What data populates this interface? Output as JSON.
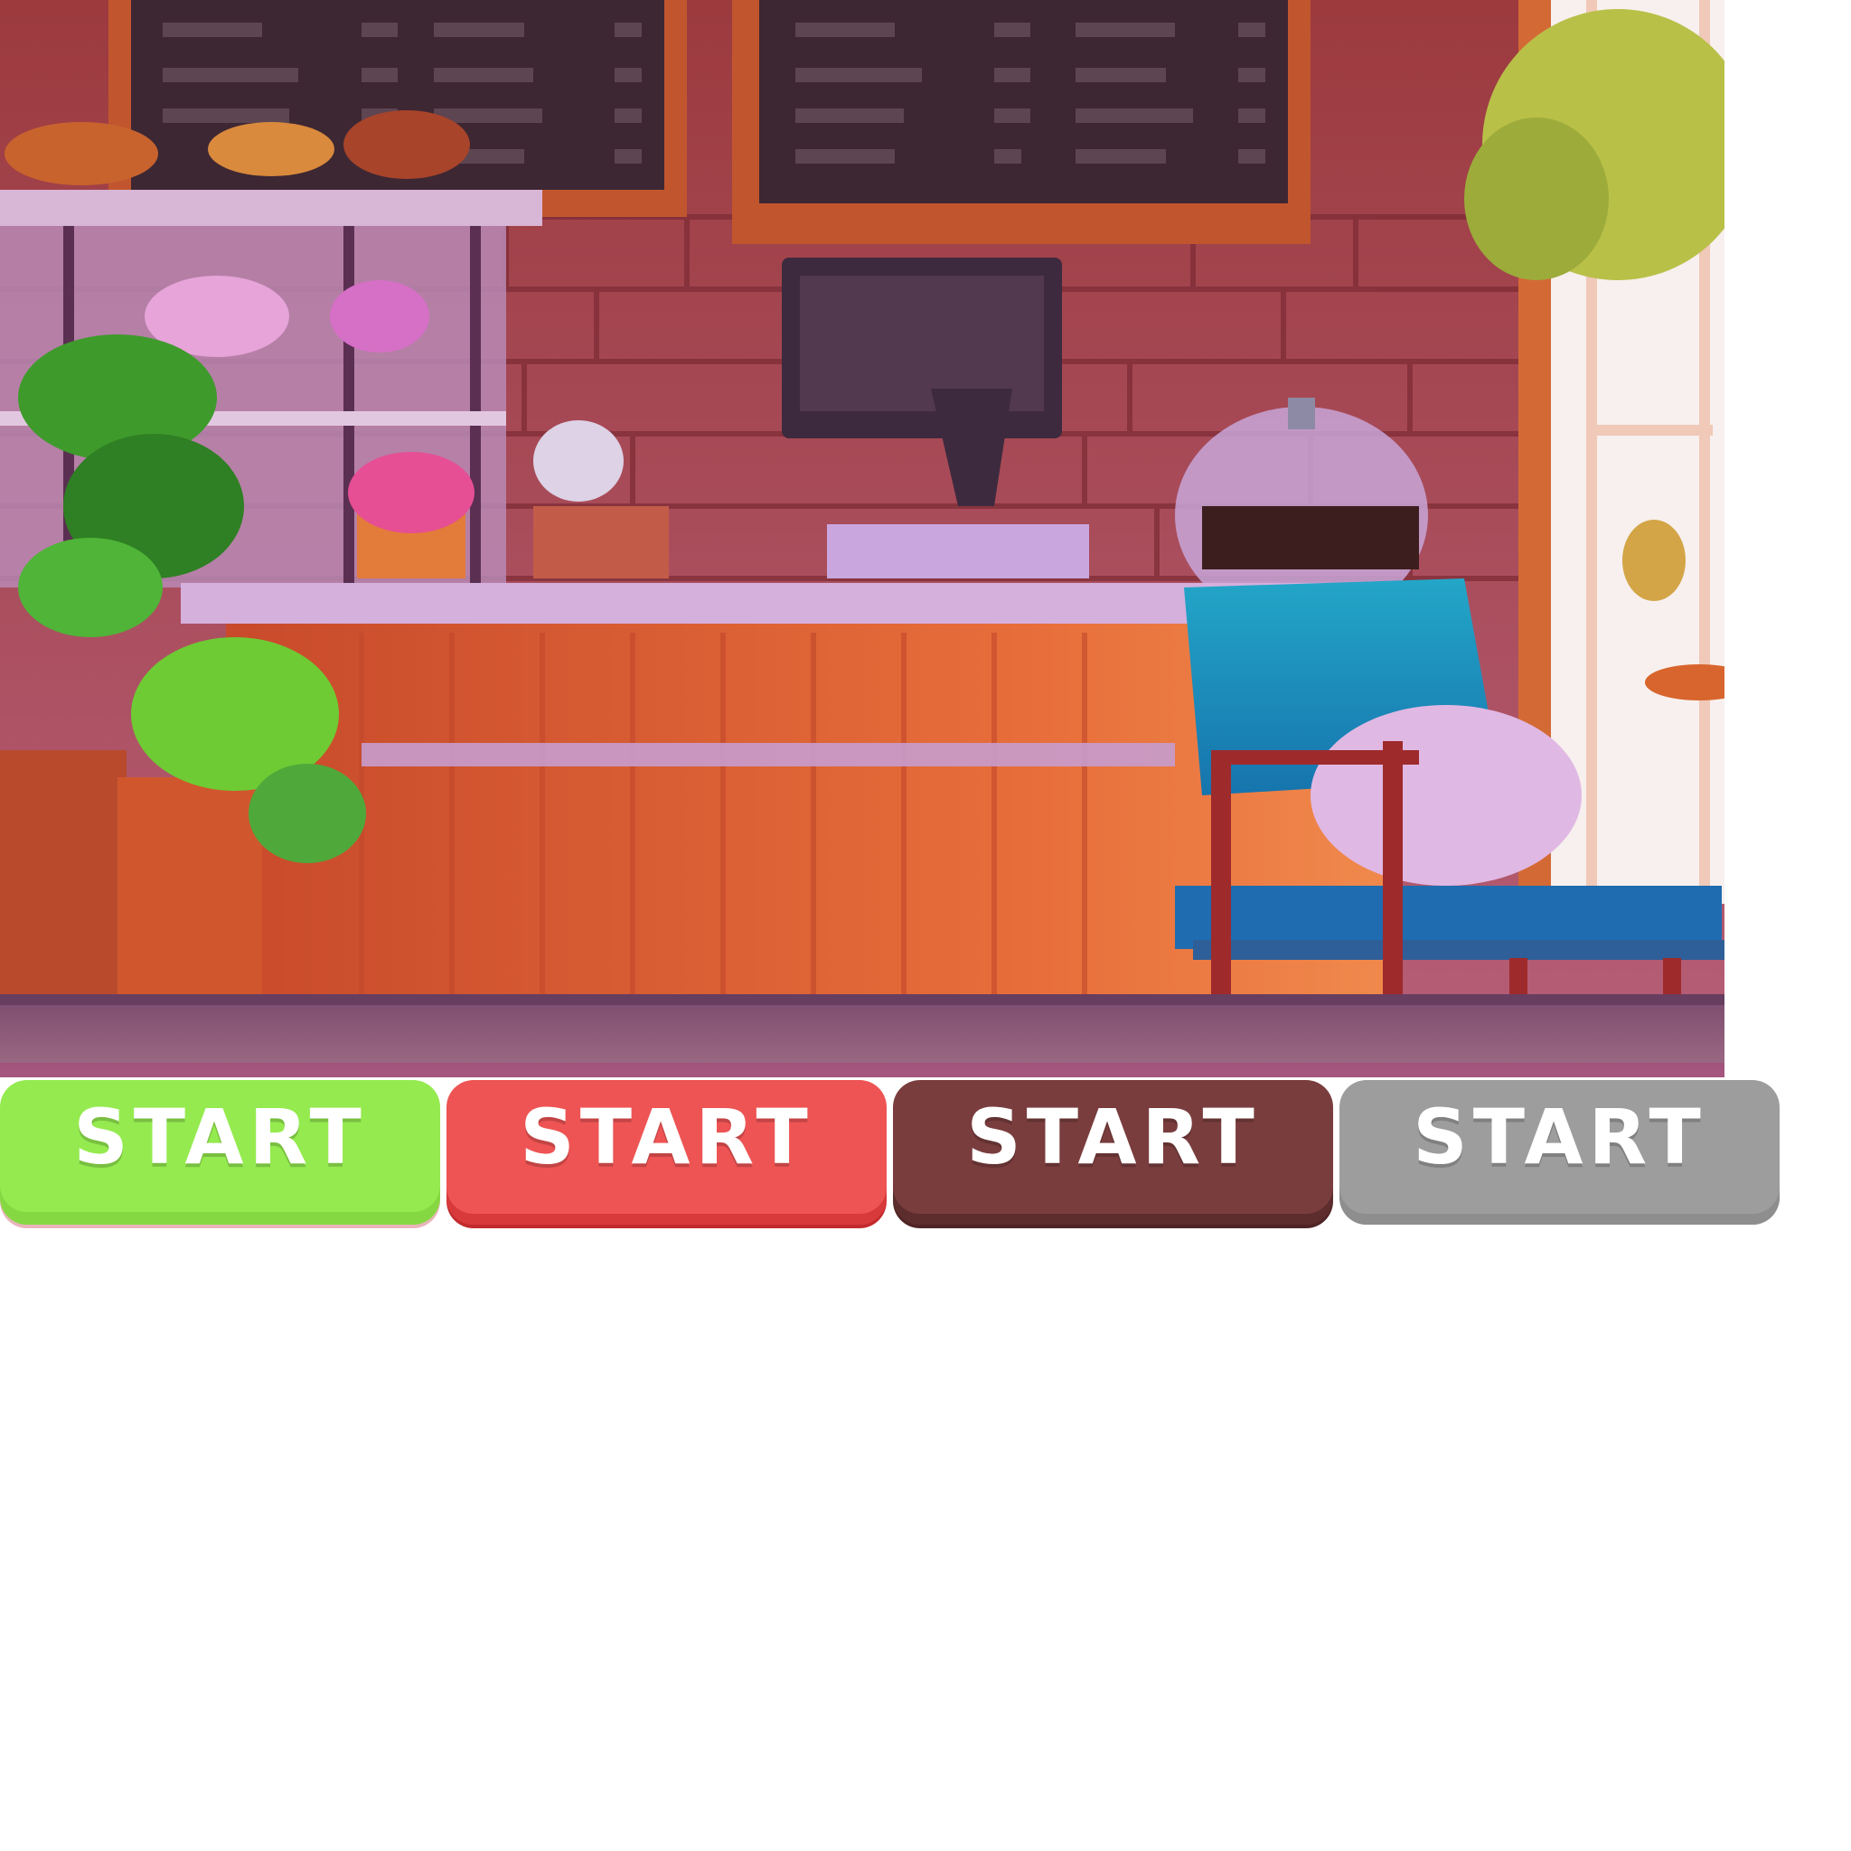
{
  "scene": {
    "description_icon": "cafe-interior-illustration"
  },
  "buttons": [
    {
      "label": "START",
      "color": "#94ea4f"
    },
    {
      "label": "START",
      "color": "#ee5454"
    },
    {
      "label": "START",
      "color": "#7a3d3e"
    },
    {
      "label": "START",
      "color": "#9d9d9d"
    }
  ]
}
